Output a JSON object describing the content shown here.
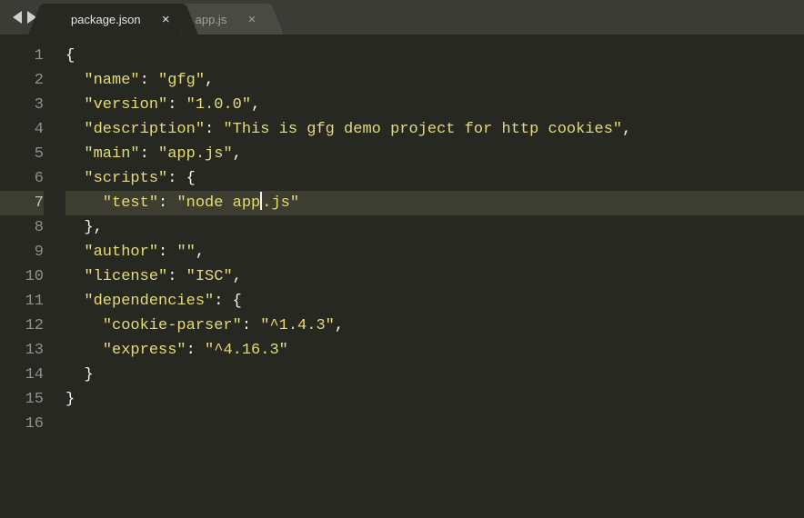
{
  "tabs": [
    {
      "label": "package.json",
      "active": true
    },
    {
      "label": "app.js",
      "active": false
    }
  ],
  "gutter_lines": [
    "1",
    "2",
    "3",
    "4",
    "5",
    "6",
    "7",
    "8",
    "9",
    "10",
    "11",
    "12",
    "13",
    "14",
    "15",
    "16"
  ],
  "highlighted_line": 7,
  "code_lines": [
    {
      "indent": 0,
      "tokens": [
        {
          "t": "punc",
          "v": "{"
        }
      ]
    },
    {
      "indent": 1,
      "tokens": [
        {
          "t": "key",
          "v": "\"name\""
        },
        {
          "t": "colon",
          "v": ": "
        },
        {
          "t": "str",
          "v": "\"gfg\""
        },
        {
          "t": "punc",
          "v": ","
        }
      ]
    },
    {
      "indent": 1,
      "tokens": [
        {
          "t": "key",
          "v": "\"version\""
        },
        {
          "t": "colon",
          "v": ": "
        },
        {
          "t": "str",
          "v": "\"1.0.0\""
        },
        {
          "t": "punc",
          "v": ","
        }
      ]
    },
    {
      "indent": 1,
      "tokens": [
        {
          "t": "key",
          "v": "\"description\""
        },
        {
          "t": "colon",
          "v": ": "
        },
        {
          "t": "str",
          "v": "\"This is gfg demo project for http cookies\""
        },
        {
          "t": "punc",
          "v": ","
        }
      ]
    },
    {
      "indent": 1,
      "tokens": [
        {
          "t": "key",
          "v": "\"main\""
        },
        {
          "t": "colon",
          "v": ": "
        },
        {
          "t": "str",
          "v": "\"app.js\""
        },
        {
          "t": "punc",
          "v": ","
        }
      ]
    },
    {
      "indent": 1,
      "tokens": [
        {
          "t": "key",
          "v": "\"scripts\""
        },
        {
          "t": "colon",
          "v": ": "
        },
        {
          "t": "punc",
          "v": "{"
        }
      ]
    },
    {
      "indent": 2,
      "tokens": [
        {
          "t": "key",
          "v": "\"test\""
        },
        {
          "t": "colon",
          "v": ": "
        },
        {
          "t": "str",
          "v": "\"node app"
        },
        {
          "t": "cursor",
          "v": ""
        },
        {
          "t": "str",
          "v": ".js\""
        }
      ]
    },
    {
      "indent": 1,
      "tokens": [
        {
          "t": "punc",
          "v": "},"
        }
      ]
    },
    {
      "indent": 1,
      "tokens": [
        {
          "t": "key",
          "v": "\"author\""
        },
        {
          "t": "colon",
          "v": ": "
        },
        {
          "t": "str",
          "v": "\"\""
        },
        {
          "t": "punc",
          "v": ","
        }
      ]
    },
    {
      "indent": 1,
      "tokens": [
        {
          "t": "key",
          "v": "\"license\""
        },
        {
          "t": "colon",
          "v": ": "
        },
        {
          "t": "str",
          "v": "\"ISC\""
        },
        {
          "t": "punc",
          "v": ","
        }
      ]
    },
    {
      "indent": 1,
      "tokens": [
        {
          "t": "key",
          "v": "\"dependencies\""
        },
        {
          "t": "colon",
          "v": ": "
        },
        {
          "t": "punc",
          "v": "{"
        }
      ]
    },
    {
      "indent": 2,
      "tokens": [
        {
          "t": "key",
          "v": "\"cookie-parser\""
        },
        {
          "t": "colon",
          "v": ": "
        },
        {
          "t": "str",
          "v": "\"^1.4.3\""
        },
        {
          "t": "punc",
          "v": ","
        }
      ]
    },
    {
      "indent": 2,
      "tokens": [
        {
          "t": "key",
          "v": "\"express\""
        },
        {
          "t": "colon",
          "v": ": "
        },
        {
          "t": "str",
          "v": "\"^4.16.3\""
        }
      ]
    },
    {
      "indent": 1,
      "tokens": [
        {
          "t": "punc",
          "v": "}"
        }
      ]
    },
    {
      "indent": 0,
      "tokens": [
        {
          "t": "punc",
          "v": "}"
        }
      ]
    },
    {
      "indent": 0,
      "tokens": []
    }
  ],
  "file_content": {
    "name": "gfg",
    "version": "1.0.0",
    "description": "This is gfg demo project for http cookies",
    "main": "app.js",
    "scripts": {
      "test": "node app.js"
    },
    "author": "",
    "license": "ISC",
    "dependencies": {
      "cookie-parser": "^1.4.3",
      "express": "^4.16.3"
    }
  }
}
